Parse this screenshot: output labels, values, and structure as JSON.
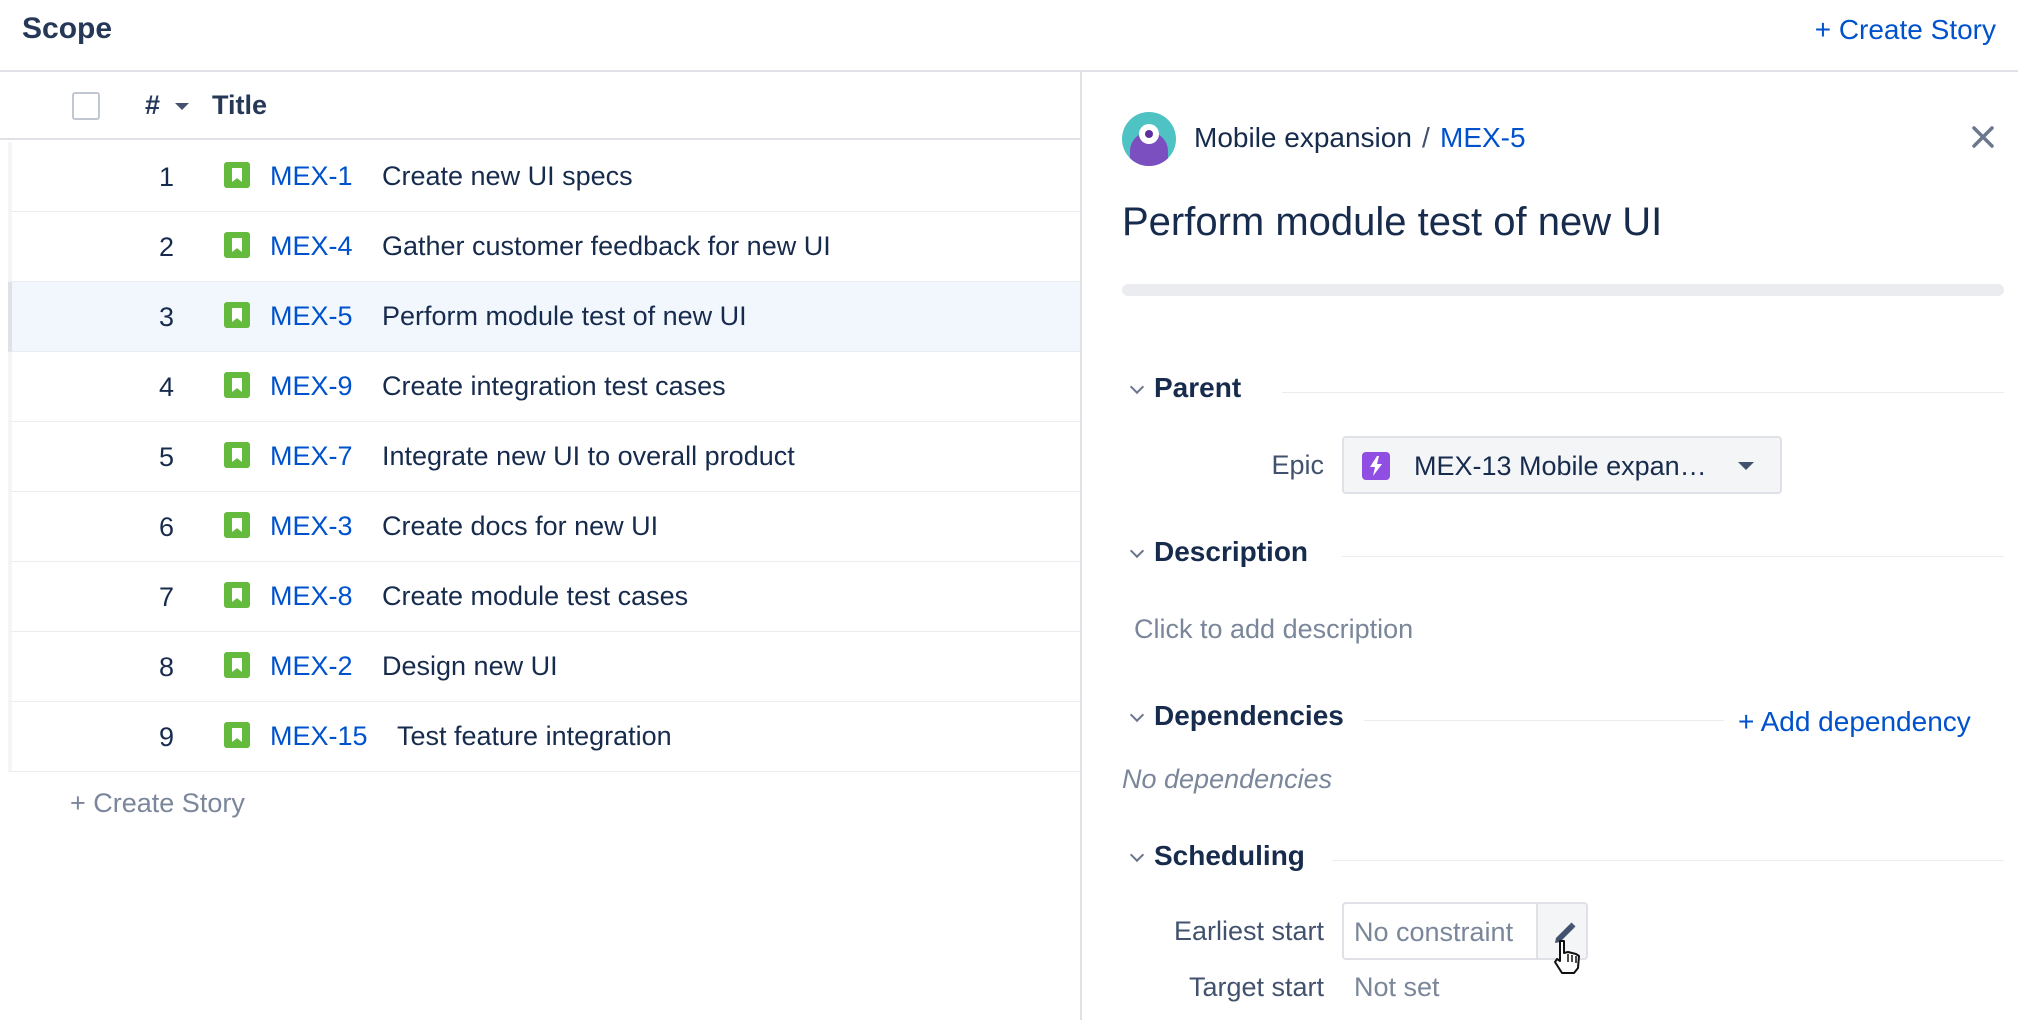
{
  "header": {
    "title": "Scope",
    "create_story_label": "+ Create Story"
  },
  "table": {
    "columns": {
      "number": "#",
      "title": "Title"
    },
    "rows": [
      {
        "num": "1",
        "key": "MEX-1",
        "summary": "Create new UI specs"
      },
      {
        "num": "2",
        "key": "MEX-4",
        "summary": "Gather customer feedback for new UI"
      },
      {
        "num": "3",
        "key": "MEX-5",
        "summary": "Perform module test of new UI"
      },
      {
        "num": "4",
        "key": "MEX-9",
        "summary": "Create integration test cases"
      },
      {
        "num": "5",
        "key": "MEX-7",
        "summary": "Integrate new UI to overall product"
      },
      {
        "num": "6",
        "key": "MEX-3",
        "summary": "Create docs for new UI"
      },
      {
        "num": "7",
        "key": "MEX-8",
        "summary": "Create module test cases"
      },
      {
        "num": "8",
        "key": "MEX-2",
        "summary": "Design new UI"
      },
      {
        "num": "9",
        "key": "MEX-15",
        "summary": "Test feature integration"
      }
    ],
    "selected_row_key": "MEX-5",
    "create_story_label": "+ Create Story"
  },
  "detail": {
    "project_name": "Mobile expansion",
    "separator": "/",
    "issue_key": "MEX-5",
    "issue_title": "Perform module test of new UI",
    "parent": {
      "section_label": "Parent",
      "epic_label": "Epic",
      "epic_value": "MEX-13 Mobile expan…"
    },
    "description": {
      "section_label": "Description",
      "placeholder": "Click to add description"
    },
    "dependencies": {
      "section_label": "Dependencies",
      "add_label": "+ Add dependency",
      "empty_text": "No dependencies"
    },
    "scheduling": {
      "section_label": "Scheduling",
      "earliest_start_label": "Earliest start",
      "earliest_start_value": "No constraint",
      "target_start_label": "Target start",
      "target_start_value": "Not set"
    }
  },
  "icons": {
    "story": "story-bookmark-icon",
    "epic": "lightning-icon",
    "close": "close-icon",
    "edit": "pencil-icon",
    "cursor": "hand-pointer-icon"
  },
  "colors": {
    "link": "#0052CC",
    "story": "#63BA3C",
    "epic": "#904EE2",
    "selected_row": "#F2F7FE"
  }
}
